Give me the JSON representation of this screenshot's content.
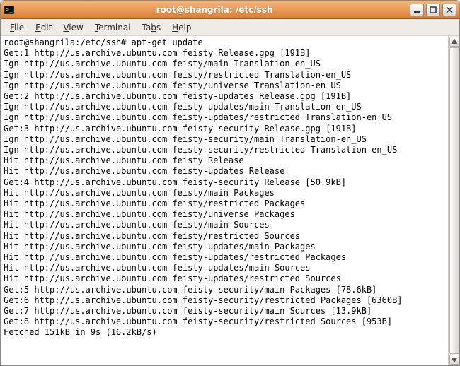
{
  "window": {
    "title": "root@shangrila: /etc/ssh"
  },
  "menu": {
    "file": "File",
    "edit": "Edit",
    "view": "View",
    "terminal": "Terminal",
    "tabs": "Tabs",
    "help": "Help"
  },
  "terminal": {
    "lines": [
      "root@shangrila:/etc/ssh# apt-get update",
      "Get:1 http://us.archive.ubuntu.com feisty Release.gpg [191B]",
      "Ign http://us.archive.ubuntu.com feisty/main Translation-en_US",
      "Ign http://us.archive.ubuntu.com feisty/restricted Translation-en_US",
      "Ign http://us.archive.ubuntu.com feisty/universe Translation-en_US",
      "Get:2 http://us.archive.ubuntu.com feisty-updates Release.gpg [191B]",
      "Ign http://us.archive.ubuntu.com feisty-updates/main Translation-en_US",
      "Ign http://us.archive.ubuntu.com feisty-updates/restricted Translation-en_US",
      "Get:3 http://us.archive.ubuntu.com feisty-security Release.gpg [191B]",
      "Ign http://us.archive.ubuntu.com feisty-security/main Translation-en_US",
      "Ign http://us.archive.ubuntu.com feisty-security/restricted Translation-en_US",
      "Hit http://us.archive.ubuntu.com feisty Release",
      "Hit http://us.archive.ubuntu.com feisty-updates Release",
      "Get:4 http://us.archive.ubuntu.com feisty-security Release [50.9kB]",
      "Hit http://us.archive.ubuntu.com feisty/main Packages",
      "Hit http://us.archive.ubuntu.com feisty/restricted Packages",
      "Hit http://us.archive.ubuntu.com feisty/universe Packages",
      "Hit http://us.archive.ubuntu.com feisty/main Sources",
      "Hit http://us.archive.ubuntu.com feisty/restricted Sources",
      "Hit http://us.archive.ubuntu.com feisty-updates/main Packages",
      "Hit http://us.archive.ubuntu.com feisty-updates/restricted Packages",
      "Hit http://us.archive.ubuntu.com feisty-updates/main Sources",
      "Hit http://us.archive.ubuntu.com feisty-updates/restricted Sources",
      "Get:5 http://us.archive.ubuntu.com feisty-security/main Packages [78.6kB]",
      "Get:6 http://us.archive.ubuntu.com feisty-security/restricted Packages [6360B]",
      "Get:7 http://us.archive.ubuntu.com feisty-security/main Sources [13.9kB]",
      "Get:8 http://us.archive.ubuntu.com feisty-security/restricted Sources [953B]",
      "Fetched 151kB in 9s (16.2kB/s)"
    ]
  }
}
